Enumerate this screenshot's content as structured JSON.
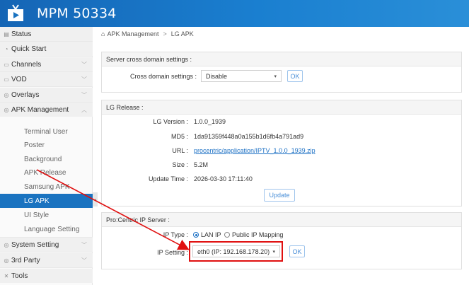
{
  "header": {
    "title": "MPM 50334",
    "logo_icon": "tv-play-icon",
    "background": "#1a73c0"
  },
  "sidebar": {
    "items": [
      {
        "label": "Status",
        "icon": "status-icon"
      },
      {
        "label": "Quick Start",
        "icon": "quick-start-icon"
      },
      {
        "label": "Channels",
        "icon": "channels-icon"
      },
      {
        "label": "VOD",
        "icon": "vod-icon"
      },
      {
        "label": "Overlays",
        "icon": "overlays-icon"
      },
      {
        "label": "APK Management",
        "icon": "apk-icon"
      }
    ],
    "sub_items": [
      {
        "label": "Terminal User"
      },
      {
        "label": "Poster"
      },
      {
        "label": "Background"
      },
      {
        "label": "APK Release"
      },
      {
        "label": "Samsung APK"
      },
      {
        "label": "LG APK"
      },
      {
        "label": "UI Style"
      },
      {
        "label": "Language Setting"
      }
    ],
    "bottom_items": [
      {
        "label": "System Setting",
        "icon": "system-icon"
      },
      {
        "label": "3rd Party",
        "icon": "third-party-icon"
      },
      {
        "label": "Tools",
        "icon": "tools-icon"
      }
    ],
    "active_color": "#1a73c0"
  },
  "breadcrumb": {
    "home_icon": "home-icon",
    "parent": "APK Management",
    "separator": ">",
    "current": "LG APK"
  },
  "cross_domain": {
    "heading": "Server cross domain settings :",
    "label": "Cross domain settings :",
    "value": "Disable",
    "ok": "OK"
  },
  "lg_release": {
    "heading": "LG Release :",
    "version_label": "LG Version :",
    "version_value": "1.0.0_1939",
    "md5_label": "MD5 :",
    "md5_value": "1da91359f448a0a155b1d6fb4a791ad9",
    "url_label": "URL :",
    "url_value": "procentric/application/IPTV_1.0.0_1939.zip",
    "size_label": "Size :",
    "size_value": "5.2M",
    "update_time_label": "Update Time :",
    "update_time_value": "2026-03-30 17:11:40",
    "update_button": "Update"
  },
  "ip_server": {
    "heading": "Pro:Centric IP Server :",
    "ip_type_label": "IP Type :",
    "ip_type_options": [
      "LAN IP",
      "Public IP Mapping"
    ],
    "ip_type_selected": "LAN IP",
    "ip_setting_label": "IP Setting :",
    "ip_setting_value": "eth0 (IP: 192.168.178.20)",
    "ok": "OK"
  },
  "annotation_color": "#e01010"
}
